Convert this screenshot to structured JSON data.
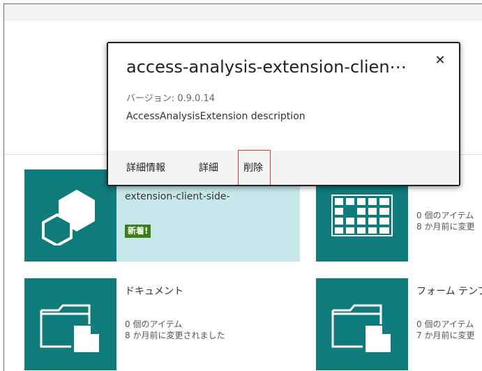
{
  "popup": {
    "title": "access-analysis-extension-clien⋯",
    "close_glyph": "✕",
    "version": "バージョン: 0.9.0.14",
    "description": "AccessAnalysisExtension description",
    "actions": [
      "詳細情報",
      "詳細",
      "削除"
    ]
  },
  "tiles": [
    {
      "title": "extension-client-side-",
      "badge": "新着!",
      "icon": "app-icon"
    },
    {
      "title": "",
      "items": "0 個のアイテム",
      "modified": "8 か月前に変更",
      "icon": "calendar-icon"
    },
    {
      "title": "ドキュメント",
      "items": "0 個のアイテム",
      "modified": "8 か月前に変更されました",
      "icon": "document-library-icon"
    },
    {
      "title": "フォーム テンプ",
      "items": "0 個のアイテム",
      "modified": "7 か月前に変更",
      "icon": "document-library-icon"
    }
  ],
  "colors": {
    "tile": "#107b7b",
    "highlight_tile": "#c7e8ea",
    "badge": "#3a7d1b",
    "action_highlight": "#e33333"
  }
}
